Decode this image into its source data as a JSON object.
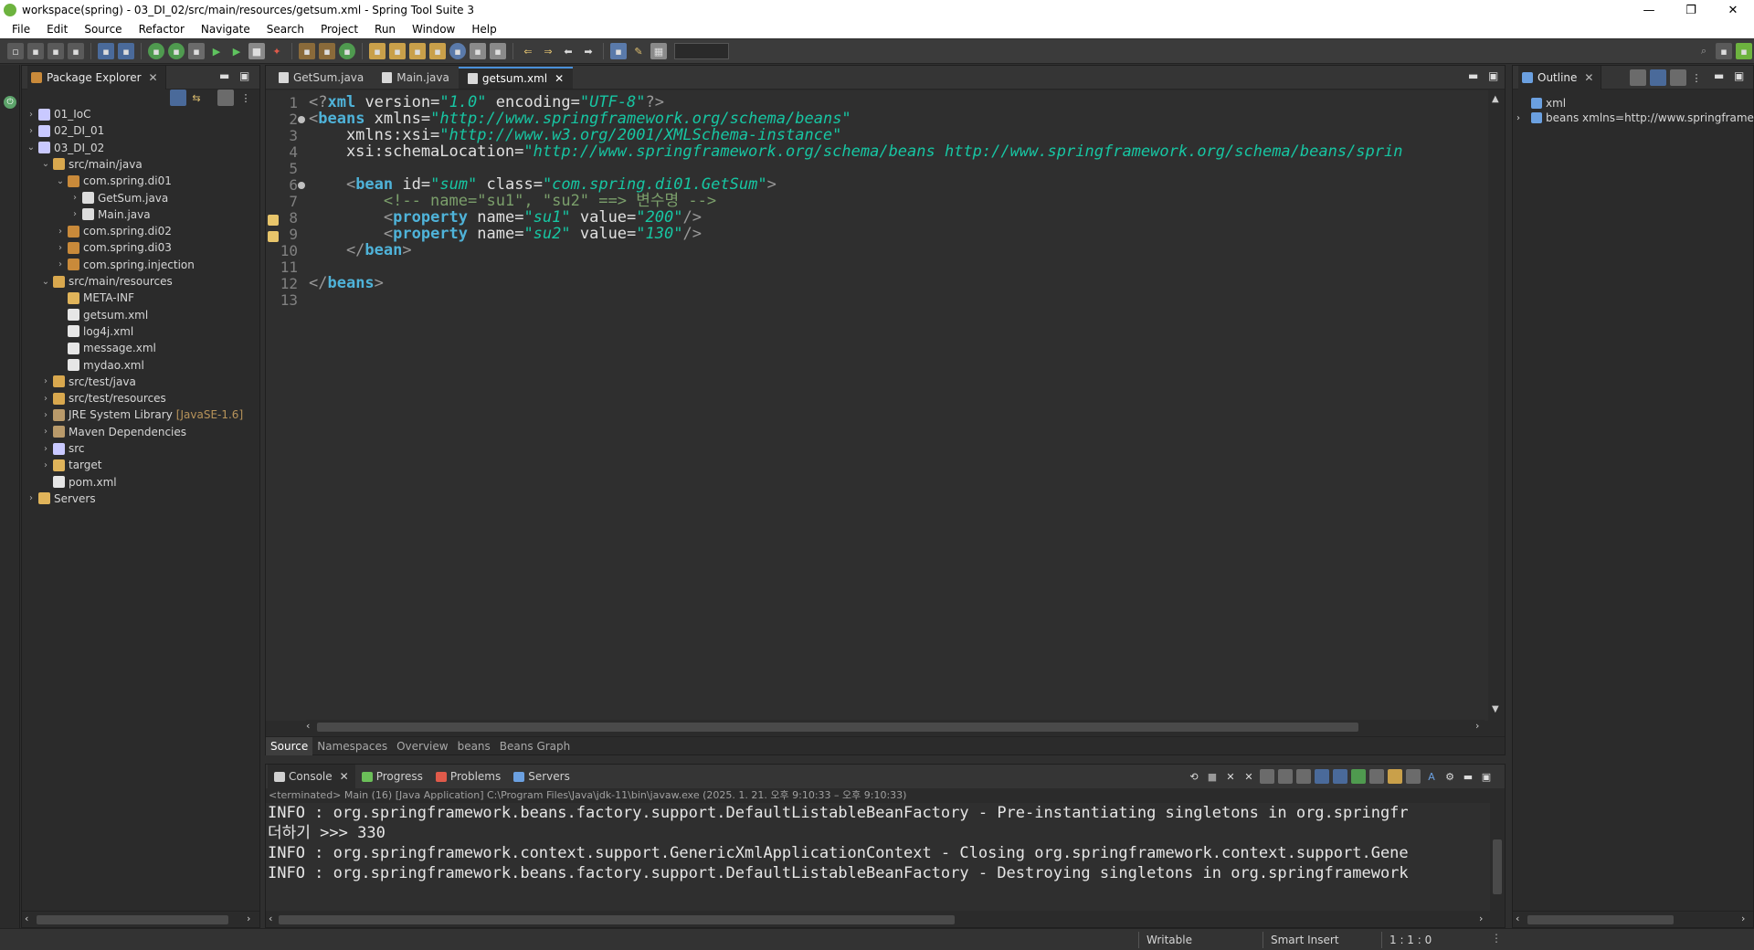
{
  "window": {
    "title": "workspace(spring) - 03_DI_02/src/main/resources/getsum.xml - Spring Tool Suite 3",
    "minimize": "—",
    "restore": "❐",
    "close": "✕"
  },
  "menu": [
    "File",
    "Edit",
    "Source",
    "Refactor",
    "Navigate",
    "Search",
    "Project",
    "Run",
    "Window",
    "Help"
  ],
  "explorer": {
    "title": "Package Explorer",
    "tree": [
      {
        "label": "01_IoC",
        "depth": 0,
        "twisty": "›",
        "icon_color": "#c9c9ff"
      },
      {
        "label": "02_DI_01",
        "depth": 0,
        "twisty": "›",
        "icon_color": "#c9c9ff"
      },
      {
        "label": "03_DI_02",
        "depth": 0,
        "twisty": "⌄",
        "icon_color": "#c9c9ff"
      },
      {
        "label": "src/main/java",
        "depth": 1,
        "twisty": "⌄",
        "icon_color": "#d9a84e"
      },
      {
        "label": "com.spring.di01",
        "depth": 2,
        "twisty": "⌄",
        "icon_color": "#c98a3a"
      },
      {
        "label": "GetSum.java",
        "depth": 3,
        "twisty": "›",
        "icon_color": "#dcdcdc"
      },
      {
        "label": "Main.java",
        "depth": 3,
        "twisty": "›",
        "icon_color": "#dcdcdc"
      },
      {
        "label": "com.spring.di02",
        "depth": 2,
        "twisty": "›",
        "icon_color": "#c98a3a"
      },
      {
        "label": "com.spring.di03",
        "depth": 2,
        "twisty": "›",
        "icon_color": "#c98a3a"
      },
      {
        "label": "com.spring.injection",
        "depth": 2,
        "twisty": "›",
        "icon_color": "#c98a3a"
      },
      {
        "label": "src/main/resources",
        "depth": 1,
        "twisty": "⌄",
        "icon_color": "#d9a84e"
      },
      {
        "label": "META-INF",
        "depth": 2,
        "twisty": "",
        "icon_color": "#e0b45a"
      },
      {
        "label": "getsum.xml",
        "depth": 2,
        "twisty": "",
        "icon_color": "#e6e6e6"
      },
      {
        "label": "log4j.xml",
        "depth": 2,
        "twisty": "",
        "icon_color": "#e6e6e6"
      },
      {
        "label": "message.xml",
        "depth": 2,
        "twisty": "",
        "icon_color": "#e6e6e6"
      },
      {
        "label": "mydao.xml",
        "depth": 2,
        "twisty": "",
        "icon_color": "#e6e6e6"
      },
      {
        "label": "src/test/java",
        "depth": 1,
        "twisty": "›",
        "icon_color": "#d9a84e"
      },
      {
        "label": "src/test/resources",
        "depth": 1,
        "twisty": "›",
        "icon_color": "#d9a84e"
      },
      {
        "label": "JRE System Library",
        "depth": 1,
        "twisty": "›",
        "icon_color": "#b99a6a",
        "deco": "[JavaSE-1.6]"
      },
      {
        "label": "Maven Dependencies",
        "depth": 1,
        "twisty": "›",
        "icon_color": "#b99a6a"
      },
      {
        "label": "src",
        "depth": 1,
        "twisty": "›",
        "icon_color": "#c9c9ff"
      },
      {
        "label": "target",
        "depth": 1,
        "twisty": "›",
        "icon_color": "#e0b45a"
      },
      {
        "label": "pom.xml",
        "depth": 1,
        "twisty": "",
        "icon_color": "#e6e6e6"
      },
      {
        "label": "Servers",
        "depth": 0,
        "twisty": "›",
        "icon_color": "#e0b45a"
      }
    ]
  },
  "editor": {
    "tabs": [
      {
        "label": "GetSum.java",
        "active": false
      },
      {
        "label": "Main.java",
        "active": false
      },
      {
        "label": "getsum.xml",
        "active": true
      }
    ],
    "lines": [
      {
        "n": "1",
        "tokens": [
          [
            "punc",
            "<?"
          ],
          [
            "tag",
            "xml"
          ],
          [
            "attr",
            " version="
          ],
          [
            "val",
            "\"1.0\""
          ],
          [
            "attr",
            " encoding="
          ],
          [
            "val",
            "\"UTF-8\""
          ],
          [
            "punc",
            "?>"
          ]
        ]
      },
      {
        "n": "2",
        "fold": true,
        "tokens": [
          [
            "punc",
            "<"
          ],
          [
            "tag",
            "beans"
          ],
          [
            "attr",
            " xmlns="
          ],
          [
            "val",
            "\"http://www.springframework.org/schema/beans\""
          ]
        ]
      },
      {
        "n": "3",
        "tokens": [
          [
            "attr",
            "    xmlns:xsi="
          ],
          [
            "val",
            "\"http://www.w3.org/2001/XMLSchema-instance\""
          ]
        ]
      },
      {
        "n": "4",
        "tokens": [
          [
            "attr",
            "    xsi:schemaLocation="
          ],
          [
            "val",
            "\"http://www.springframework.org/schema/beans http://www.springframework.org/schema/beans/sprin"
          ]
        ]
      },
      {
        "n": "5",
        "tokens": []
      },
      {
        "n": "6",
        "fold": true,
        "tokens": [
          [
            "punc",
            "    <"
          ],
          [
            "tag",
            "bean"
          ],
          [
            "attr",
            " id="
          ],
          [
            "val",
            "\"sum\""
          ],
          [
            "attr",
            " class="
          ],
          [
            "val",
            "\"com.spring.di01.GetSum\""
          ],
          [
            "punc",
            ">"
          ]
        ]
      },
      {
        "n": "7",
        "tokens": [
          [
            "cmt",
            "        <!-- name=\"su1\", \"su2\" ==> 변수명 -->"
          ]
        ]
      },
      {
        "n": "8",
        "marker": true,
        "tokens": [
          [
            "punc",
            "        <"
          ],
          [
            "tag",
            "property"
          ],
          [
            "attr",
            " name="
          ],
          [
            "val",
            "\"su1\""
          ],
          [
            "attr",
            " value="
          ],
          [
            "val",
            "\"200\""
          ],
          [
            "punc",
            "/>"
          ]
        ]
      },
      {
        "n": "9",
        "marker": true,
        "tokens": [
          [
            "punc",
            "        <"
          ],
          [
            "tag",
            "property"
          ],
          [
            "attr",
            " name="
          ],
          [
            "val",
            "\"su2\""
          ],
          [
            "attr",
            " value="
          ],
          [
            "val",
            "\"130\""
          ],
          [
            "punc",
            "/>"
          ]
        ]
      },
      {
        "n": "10",
        "tokens": [
          [
            "punc",
            "    </"
          ],
          [
            "tag",
            "bean"
          ],
          [
            "punc",
            ">"
          ]
        ]
      },
      {
        "n": "11",
        "tokens": []
      },
      {
        "n": "12",
        "tokens": [
          [
            "punc",
            "</"
          ],
          [
            "tag",
            "beans"
          ],
          [
            "punc",
            ">"
          ]
        ]
      },
      {
        "n": "13",
        "tokens": []
      }
    ],
    "subtabs": [
      {
        "label": "Source",
        "active": true
      },
      {
        "label": "Namespaces",
        "active": false
      },
      {
        "label": "Overview",
        "active": false
      },
      {
        "label": "beans",
        "active": false
      },
      {
        "label": "Beans Graph",
        "active": false
      }
    ]
  },
  "console": {
    "tabs": [
      {
        "label": "Console",
        "active": true,
        "icon_color": "#d0d0d0"
      },
      {
        "label": "Progress",
        "active": false,
        "icon_color": "#6bbf59"
      },
      {
        "label": "Problems",
        "active": false,
        "icon_color": "#e05a4a"
      },
      {
        "label": "Servers",
        "active": false,
        "icon_color": "#6ba0e0"
      }
    ],
    "status": "<terminated> Main (16) [Java Application] C:\\Program Files\\Java\\jdk-11\\bin\\javaw.exe  (2025. 1. 21. 오후 9:10:33 – 오후 9:10:33)",
    "output": [
      "INFO : org.springframework.beans.factory.support.DefaultListableBeanFactory - Pre-instantiating singletons in org.springfr",
      "더하기 >>> 330",
      "INFO : org.springframework.context.support.GenericXmlApplicationContext - Closing org.springframework.context.support.Gene",
      "INFO : org.springframework.beans.factory.support.DefaultListableBeanFactory - Destroying singletons in org.springframework"
    ]
  },
  "outline": {
    "title": "Outline",
    "items": [
      {
        "label": "xml",
        "twisty": "",
        "icon_color": "#6ba0e0"
      },
      {
        "label": "beans xmlns=http://www.springframewor",
        "twisty": "›",
        "icon_color": "#6ba0e0"
      }
    ]
  },
  "statusbar": {
    "writable": "Writable",
    "insert_mode": "Smart Insert",
    "position": "1 : 1 : 0"
  }
}
